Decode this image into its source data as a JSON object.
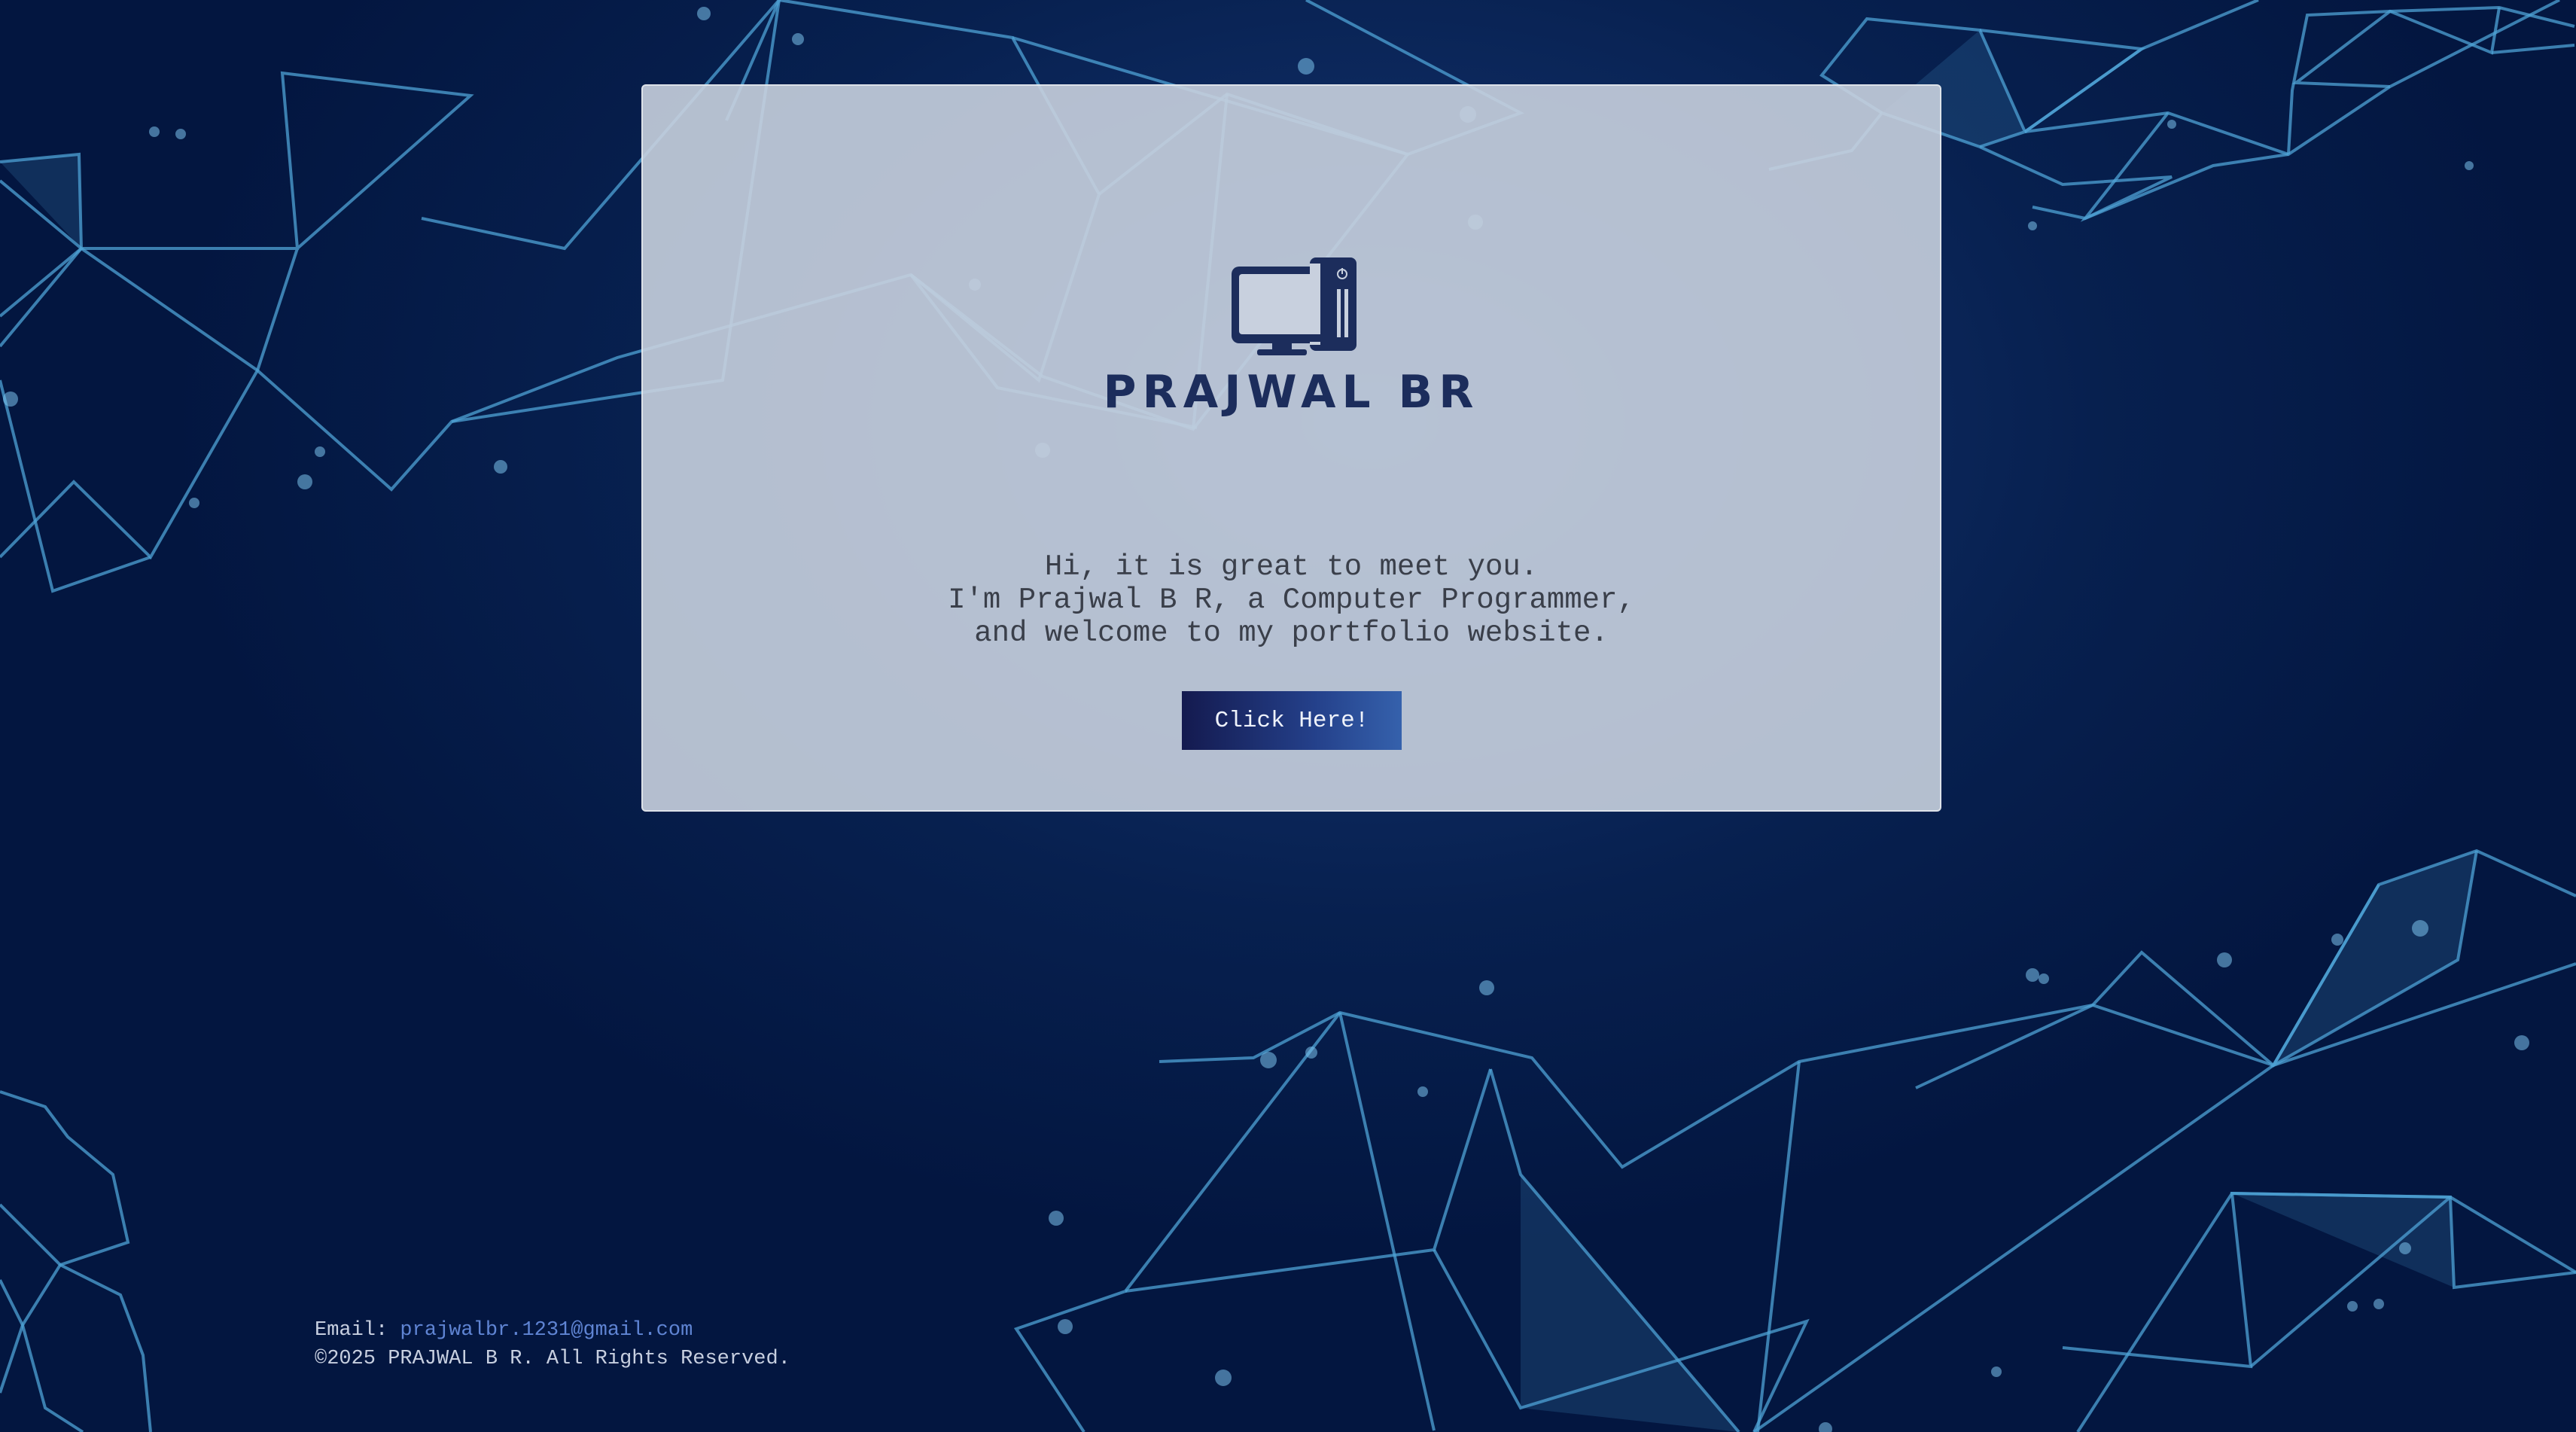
{
  "brand": {
    "name": "PRAJWAL BR",
    "logo_icon": "computer-icon"
  },
  "hero": {
    "lines": [
      "Hi, it is great to meet you.",
      "I'm Prajwal B R, a Computer Programmer,",
      "and welcome to my portfolio website."
    ],
    "button_label": "Click Here!"
  },
  "footer": {
    "email_label": "Email:",
    "email": "prajwalbr.1231@gmail.com",
    "copyright": "©2025 PRAJWAL B R. All Rights Reserved."
  },
  "colors": {
    "background_dark": "#031640",
    "background_light": "#1a3f7a",
    "network_lines": "#4fa3d6",
    "brand_text": "#1c2d5c",
    "link": "#5f84d3",
    "button_start": "#141a4f",
    "button_end": "#3561ac"
  }
}
